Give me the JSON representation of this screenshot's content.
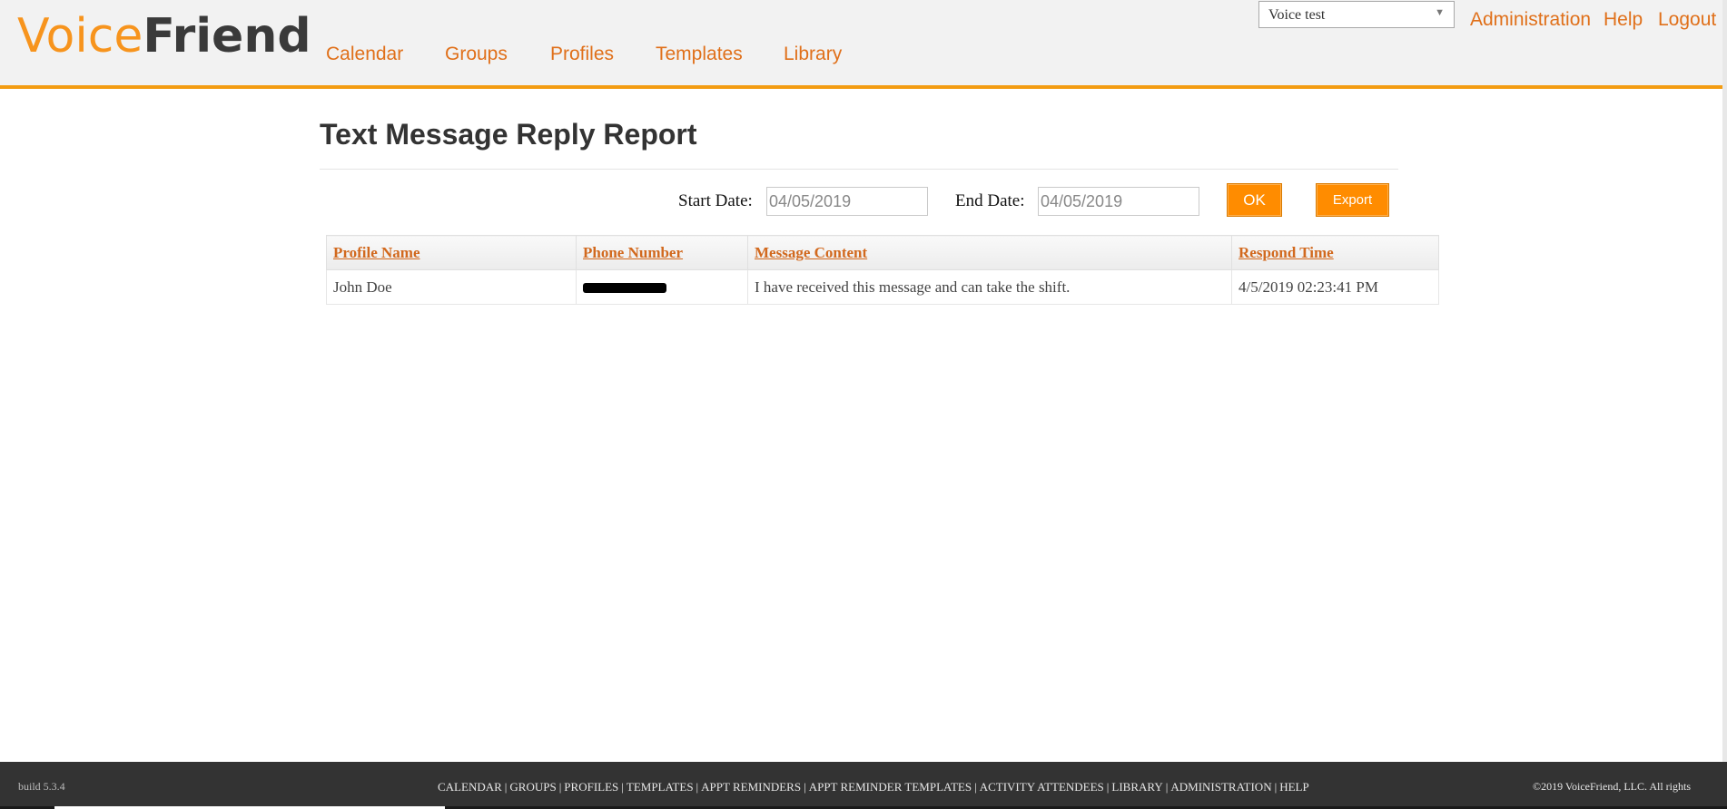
{
  "app": {
    "logo_voice": "Voice",
    "logo_friend": "Friend"
  },
  "nav": {
    "items": [
      {
        "label": "Calendar"
      },
      {
        "label": "Groups"
      },
      {
        "label": "Profiles"
      },
      {
        "label": "Templates"
      },
      {
        "label": "Library"
      }
    ]
  },
  "account": {
    "selected": "Voice test"
  },
  "toplinks": {
    "administration": "Administration",
    "help": "Help",
    "logout": "Logout"
  },
  "page": {
    "title": "Text Message Reply Report"
  },
  "filters": {
    "start_label": "Start Date:",
    "start_value": "04/05/2019",
    "end_label": "End Date:",
    "end_value": "04/05/2019",
    "ok_label": "OK",
    "export_label": "Export"
  },
  "table": {
    "headers": [
      "Profile Name",
      "Phone Number",
      "Message Content",
      "Respond Time"
    ],
    "rows": [
      {
        "profile_name": "John Doe",
        "phone_number": "",
        "message": "I have received this message and can take the shift.",
        "respond_time": "4/5/2019 02:23:41 PM"
      }
    ]
  },
  "footer": {
    "build": "build 5.3.4",
    "links": [
      "CALENDAR",
      "GROUPS",
      "PROFILES",
      "TEMPLATES",
      "APPT REMINDERS",
      "APPT REMINDER TEMPLATES",
      "ACTIVITY ATTENDEES",
      "LIBRARY",
      "ADMINISTRATION",
      "HELP"
    ],
    "copyright": "©2019 VoiceFriend, LLC. All rights"
  },
  "colors": {
    "accent": "#f39c12",
    "link": "#e0701a",
    "button": "#ff8c00",
    "footer_bg": "#333333"
  }
}
